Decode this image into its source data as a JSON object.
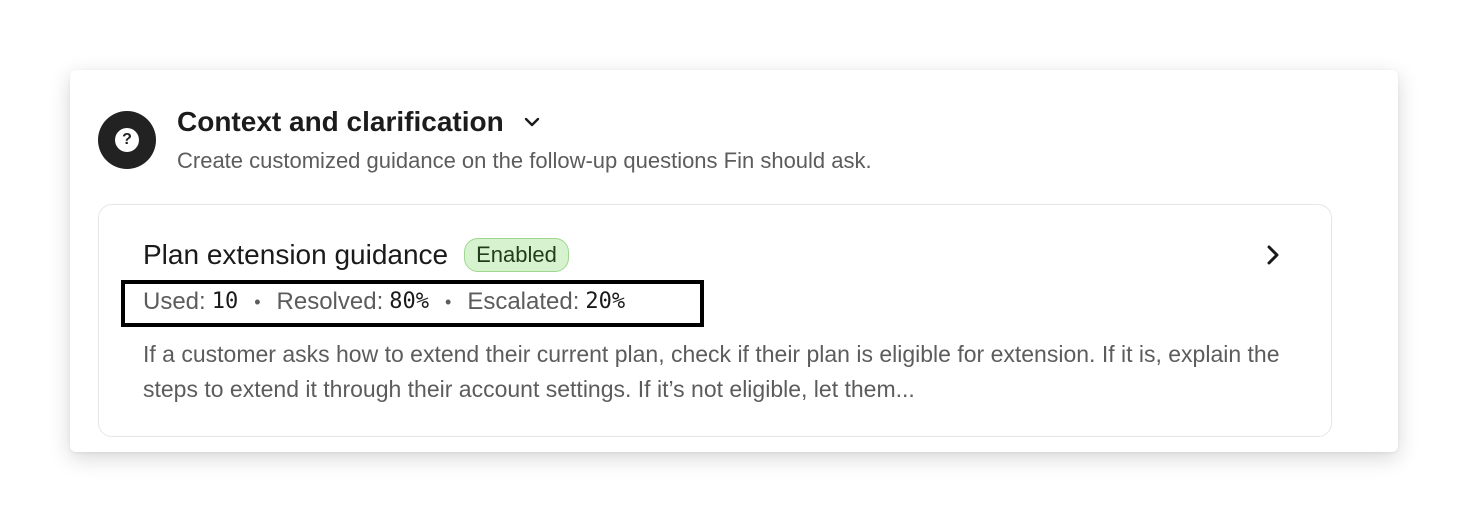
{
  "section": {
    "icon": "question-mark-icon",
    "title": "Context and clarification",
    "subtitle": "Create customized guidance on the follow-up questions Fin should ask."
  },
  "guidance": {
    "title": "Plan extension guidance",
    "status": "Enabled",
    "stats": {
      "used_label": "Used:",
      "used_value": "10",
      "resolved_label": "Resolved:",
      "resolved_value": "80%",
      "escalated_label": "Escalated:",
      "escalated_value": "20%",
      "separator": "•"
    },
    "description": "If a customer asks how to extend their current plan, check if their plan is eligible for extension. If it is, explain the steps to extend it through their account settings. If it’s not eligible, let them..."
  },
  "colors": {
    "badge_bg": "#d7f2cf",
    "badge_border": "#9fd791",
    "icon_bg": "#222222",
    "highlight": "#000000"
  }
}
